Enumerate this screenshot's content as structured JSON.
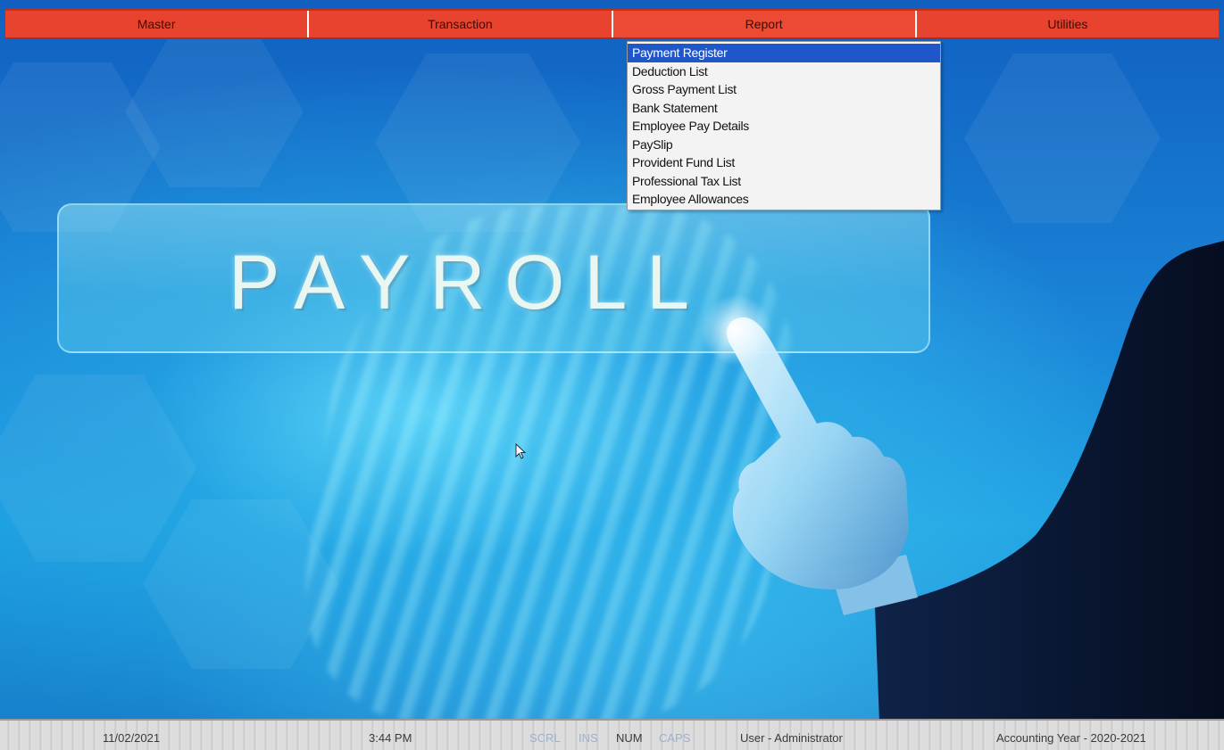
{
  "menu": {
    "items": [
      {
        "label": "Master"
      },
      {
        "label": "Transaction"
      },
      {
        "label": "Report"
      },
      {
        "label": "Utilities"
      }
    ],
    "active_index": 2
  },
  "report_menu": {
    "items": [
      {
        "label": "Payment Register",
        "selected": true
      },
      {
        "label": "Deduction List",
        "selected": false
      },
      {
        "label": "Gross Payment List",
        "selected": false
      },
      {
        "label": "Bank Statement",
        "selected": false
      },
      {
        "label": "Employee Pay Details",
        "selected": false
      },
      {
        "label": "PaySlip",
        "selected": false
      },
      {
        "label": "Provident Fund List",
        "selected": false
      },
      {
        "label": "Professional Tax List",
        "selected": false
      },
      {
        "label": "Employee Allowances",
        "selected": false
      }
    ]
  },
  "banner": {
    "title": "PAYROLL"
  },
  "statusbar": {
    "date": "11/02/2021",
    "time": "3:44 PM",
    "scroll": "SCRL",
    "insert": "INS",
    "num": "NUM",
    "caps": "CAPS",
    "user": "User - Administrator",
    "accounting_year": "Accounting Year - 2020-2021"
  },
  "colors": {
    "menu_bar": "#e8432e",
    "selection": "#1f56c9",
    "background": "#1a86d8"
  },
  "icons": {
    "cursor": "mouse-pointer-icon"
  }
}
